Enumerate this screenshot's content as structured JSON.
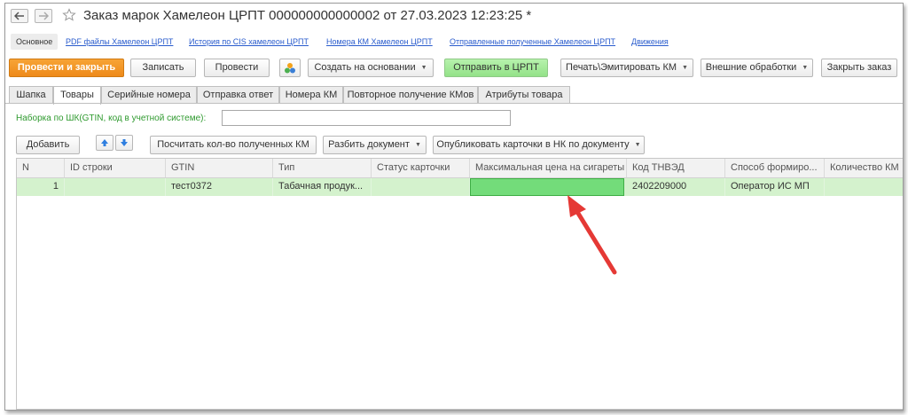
{
  "window": {
    "title": "Заказ марок Хамелеон ЦРПТ 000000000000002 от 27.03.2023 12:23:25 *"
  },
  "links": [
    {
      "label": "Основное"
    },
    {
      "label": "PDF файлы  Хамелеон ЦРПТ"
    },
    {
      "label": "История по CIS хамелеон ЦРПТ"
    },
    {
      "label": "Номера КМ Хамелеон ЦРПТ"
    },
    {
      "label": "Отправленные полученные Хамелеон ЦРПТ"
    },
    {
      "label": "Движения"
    }
  ],
  "toolbar": {
    "post_close": "Провести и закрыть",
    "save": "Записать",
    "post": "Провести",
    "create_based": "Создать на основании",
    "send_crpt": "Отправить в ЦРПТ",
    "print_emit": "Печать\\Эмитировать КМ",
    "external": "Внешние обработки",
    "close_order": "Закрыть заказ"
  },
  "tabs": [
    {
      "label": "Шапка"
    },
    {
      "label": "Товары"
    },
    {
      "label": "Серийные номера"
    },
    {
      "label": "Отправка ответ"
    },
    {
      "label": "Номера КМ"
    },
    {
      "label": "Повторное получение КМов"
    },
    {
      "label": "Атрибуты товара"
    }
  ],
  "filter": {
    "label": "Наборка по ШК(GTIN, код в учетной системе):",
    "value": ""
  },
  "toolbar2": {
    "add": "Добавить",
    "count_received": "Посчитать кол-во полученных КМ",
    "split_doc": "Разбить документ",
    "publish_cards": "Опубликовать карточки в НК по документу"
  },
  "grid": {
    "columns": [
      "N",
      "ID строки",
      "GTIN",
      "Тип",
      "Статус карточки",
      "Максимальная цена на сигареты",
      "Код ТНВЭД",
      "Способ формиро...",
      "Количество КМ"
    ],
    "rows": [
      [
        "1",
        "",
        "тест0372",
        "Табачная продук...",
        "",
        "",
        "2402209000",
        "Оператор ИС МП",
        ""
      ]
    ]
  },
  "colors": {
    "accent_orange": "#f29a2e",
    "send_green": "#a5eb9a",
    "row_highlight": "#d4f2cd",
    "active_cell": "#73dc7a",
    "annotation_arrow": "#e53935",
    "link_blue": "#2a5ccd"
  }
}
